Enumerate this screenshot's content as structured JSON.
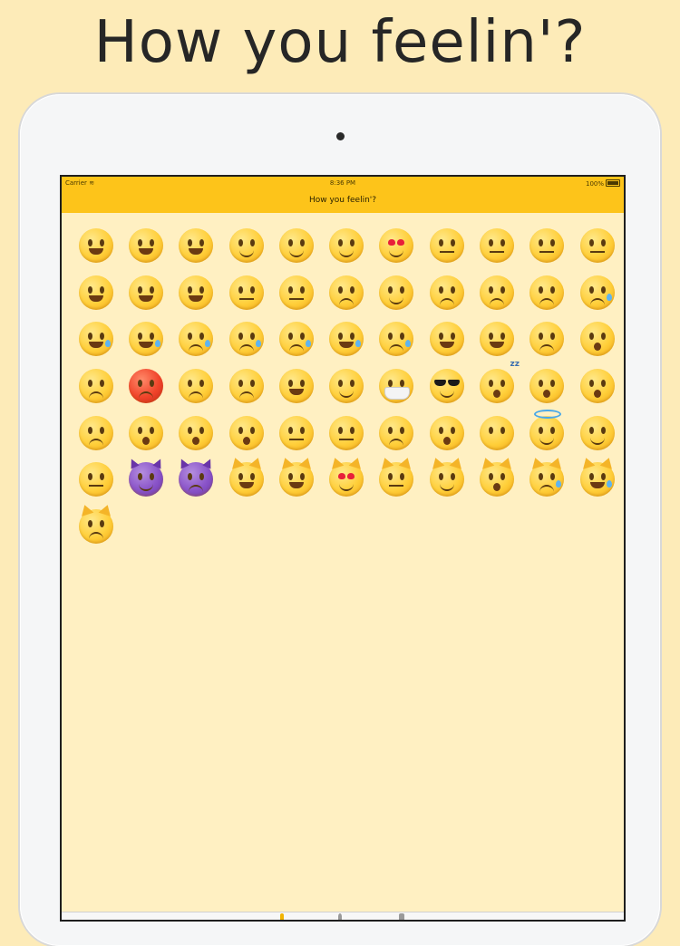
{
  "promo": {
    "title": "How you feelin'?"
  },
  "status_bar": {
    "carrier": "Carrier",
    "time": "8:36 PM",
    "battery": "100%"
  },
  "nav": {
    "title": "How you feelin'?"
  },
  "colors": {
    "accent": "#fdc41a",
    "background": "#fdebb8",
    "screen_background": "#fff0c2"
  },
  "emojis": [
    {
      "name": "grinning-face-smiling-eyes",
      "style": "open"
    },
    {
      "name": "smiling-face-open-mouth",
      "style": "open"
    },
    {
      "name": "grinning-face",
      "style": "open"
    },
    {
      "name": "smiling-face-smiling-eyes",
      "style": ""
    },
    {
      "name": "relaxed-face",
      "style": ""
    },
    {
      "name": "winking-face",
      "style": ""
    },
    {
      "name": "heart-eyes-face",
      "style": "hearts"
    },
    {
      "name": "face-blowing-kiss",
      "style": "flat"
    },
    {
      "name": "kissing-face-smiling-eyes",
      "style": "flat"
    },
    {
      "name": "kissing-face",
      "style": "flat"
    },
    {
      "name": "kissing-face-closed-eyes",
      "style": "flat"
    },
    {
      "name": "winking-tongue-face",
      "style": "open"
    },
    {
      "name": "squinting-tongue-face",
      "style": "open"
    },
    {
      "name": "tongue-face",
      "style": "open"
    },
    {
      "name": "flushed-face",
      "style": "flat"
    },
    {
      "name": "grimacing-face",
      "style": "flat"
    },
    {
      "name": "pensive-face",
      "style": "sad"
    },
    {
      "name": "relieved-face",
      "style": ""
    },
    {
      "name": "unamused-face",
      "style": "sad"
    },
    {
      "name": "disappointed-face",
      "style": "sad"
    },
    {
      "name": "persevering-face",
      "style": "sad"
    },
    {
      "name": "crying-face",
      "style": "sad",
      "tear": true
    },
    {
      "name": "tears-of-joy-face",
      "style": "open",
      "tear": true
    },
    {
      "name": "loudly-crying-face",
      "style": "open",
      "tear": true
    },
    {
      "name": "sleepy-face",
      "style": "sad",
      "tear": true
    },
    {
      "name": "disappointed-relieved-face",
      "style": "sad",
      "tear": true
    },
    {
      "name": "anxious-sweat-face",
      "style": "sad",
      "tear": true
    },
    {
      "name": "grinning-sweat-face",
      "style": "open",
      "tear": true
    },
    {
      "name": "downcast-sweat-face",
      "style": "sad",
      "tear": true
    },
    {
      "name": "weary-face",
      "style": "open"
    },
    {
      "name": "tired-face",
      "style": "open"
    },
    {
      "name": "fearful-face",
      "style": "sad"
    },
    {
      "name": "screaming-face",
      "style": "shock"
    },
    {
      "name": "angry-face",
      "style": "sad"
    },
    {
      "name": "pouting-face",
      "style": "sad",
      "color": "red"
    },
    {
      "name": "triumph-face",
      "style": "sad"
    },
    {
      "name": "confounded-face",
      "style": "sad"
    },
    {
      "name": "laughing-face",
      "style": "open"
    },
    {
      "name": "savoring-food-face",
      "style": ""
    },
    {
      "name": "medical-mask-face",
      "style": "flat",
      "mask": true
    },
    {
      "name": "sunglasses-face",
      "style": "shades"
    },
    {
      "name": "sleeping-face",
      "style": "shock",
      "zzz": true
    },
    {
      "name": "dizzy-face",
      "style": "shock"
    },
    {
      "name": "astonished-face",
      "style": "shock"
    },
    {
      "name": "worried-face",
      "style": "sad"
    },
    {
      "name": "frowning-open-mouth-face",
      "style": "shock"
    },
    {
      "name": "anguished-face",
      "style": "shock"
    },
    {
      "name": "open-mouth-face",
      "style": "shock"
    },
    {
      "name": "grimacing-teeth-face",
      "style": "flat"
    },
    {
      "name": "neutral-face",
      "style": "flat"
    },
    {
      "name": "confused-face",
      "style": "sad"
    },
    {
      "name": "hushed-face",
      "style": "shock"
    },
    {
      "name": "no-mouth-face",
      "style": "none"
    },
    {
      "name": "halo-face",
      "style": "",
      "halo": true
    },
    {
      "name": "smirking-face",
      "style": ""
    },
    {
      "name": "expressionless-face",
      "style": "flat"
    },
    {
      "name": "smiling-imp",
      "style": "",
      "color": "purple",
      "horns": true
    },
    {
      "name": "imp-face",
      "style": "sad",
      "color": "purple",
      "horns": true
    },
    {
      "name": "grinning-cat",
      "style": "open",
      "ears": true
    },
    {
      "name": "joy-cat",
      "style": "open",
      "ears": true
    },
    {
      "name": "heart-eyes-cat",
      "style": "hearts",
      "ears": true
    },
    {
      "name": "kissing-cat",
      "style": "flat",
      "ears": true
    },
    {
      "name": "smirk-cat",
      "style": "",
      "ears": true
    },
    {
      "name": "weary-cat",
      "style": "shock",
      "ears": true
    },
    {
      "name": "crying-cat",
      "style": "sad",
      "ears": true,
      "tear": true
    },
    {
      "name": "tears-of-joy-cat",
      "style": "open",
      "ears": true,
      "tear": true
    },
    {
      "name": "pouting-cat",
      "style": "sad",
      "ears": true
    }
  ]
}
